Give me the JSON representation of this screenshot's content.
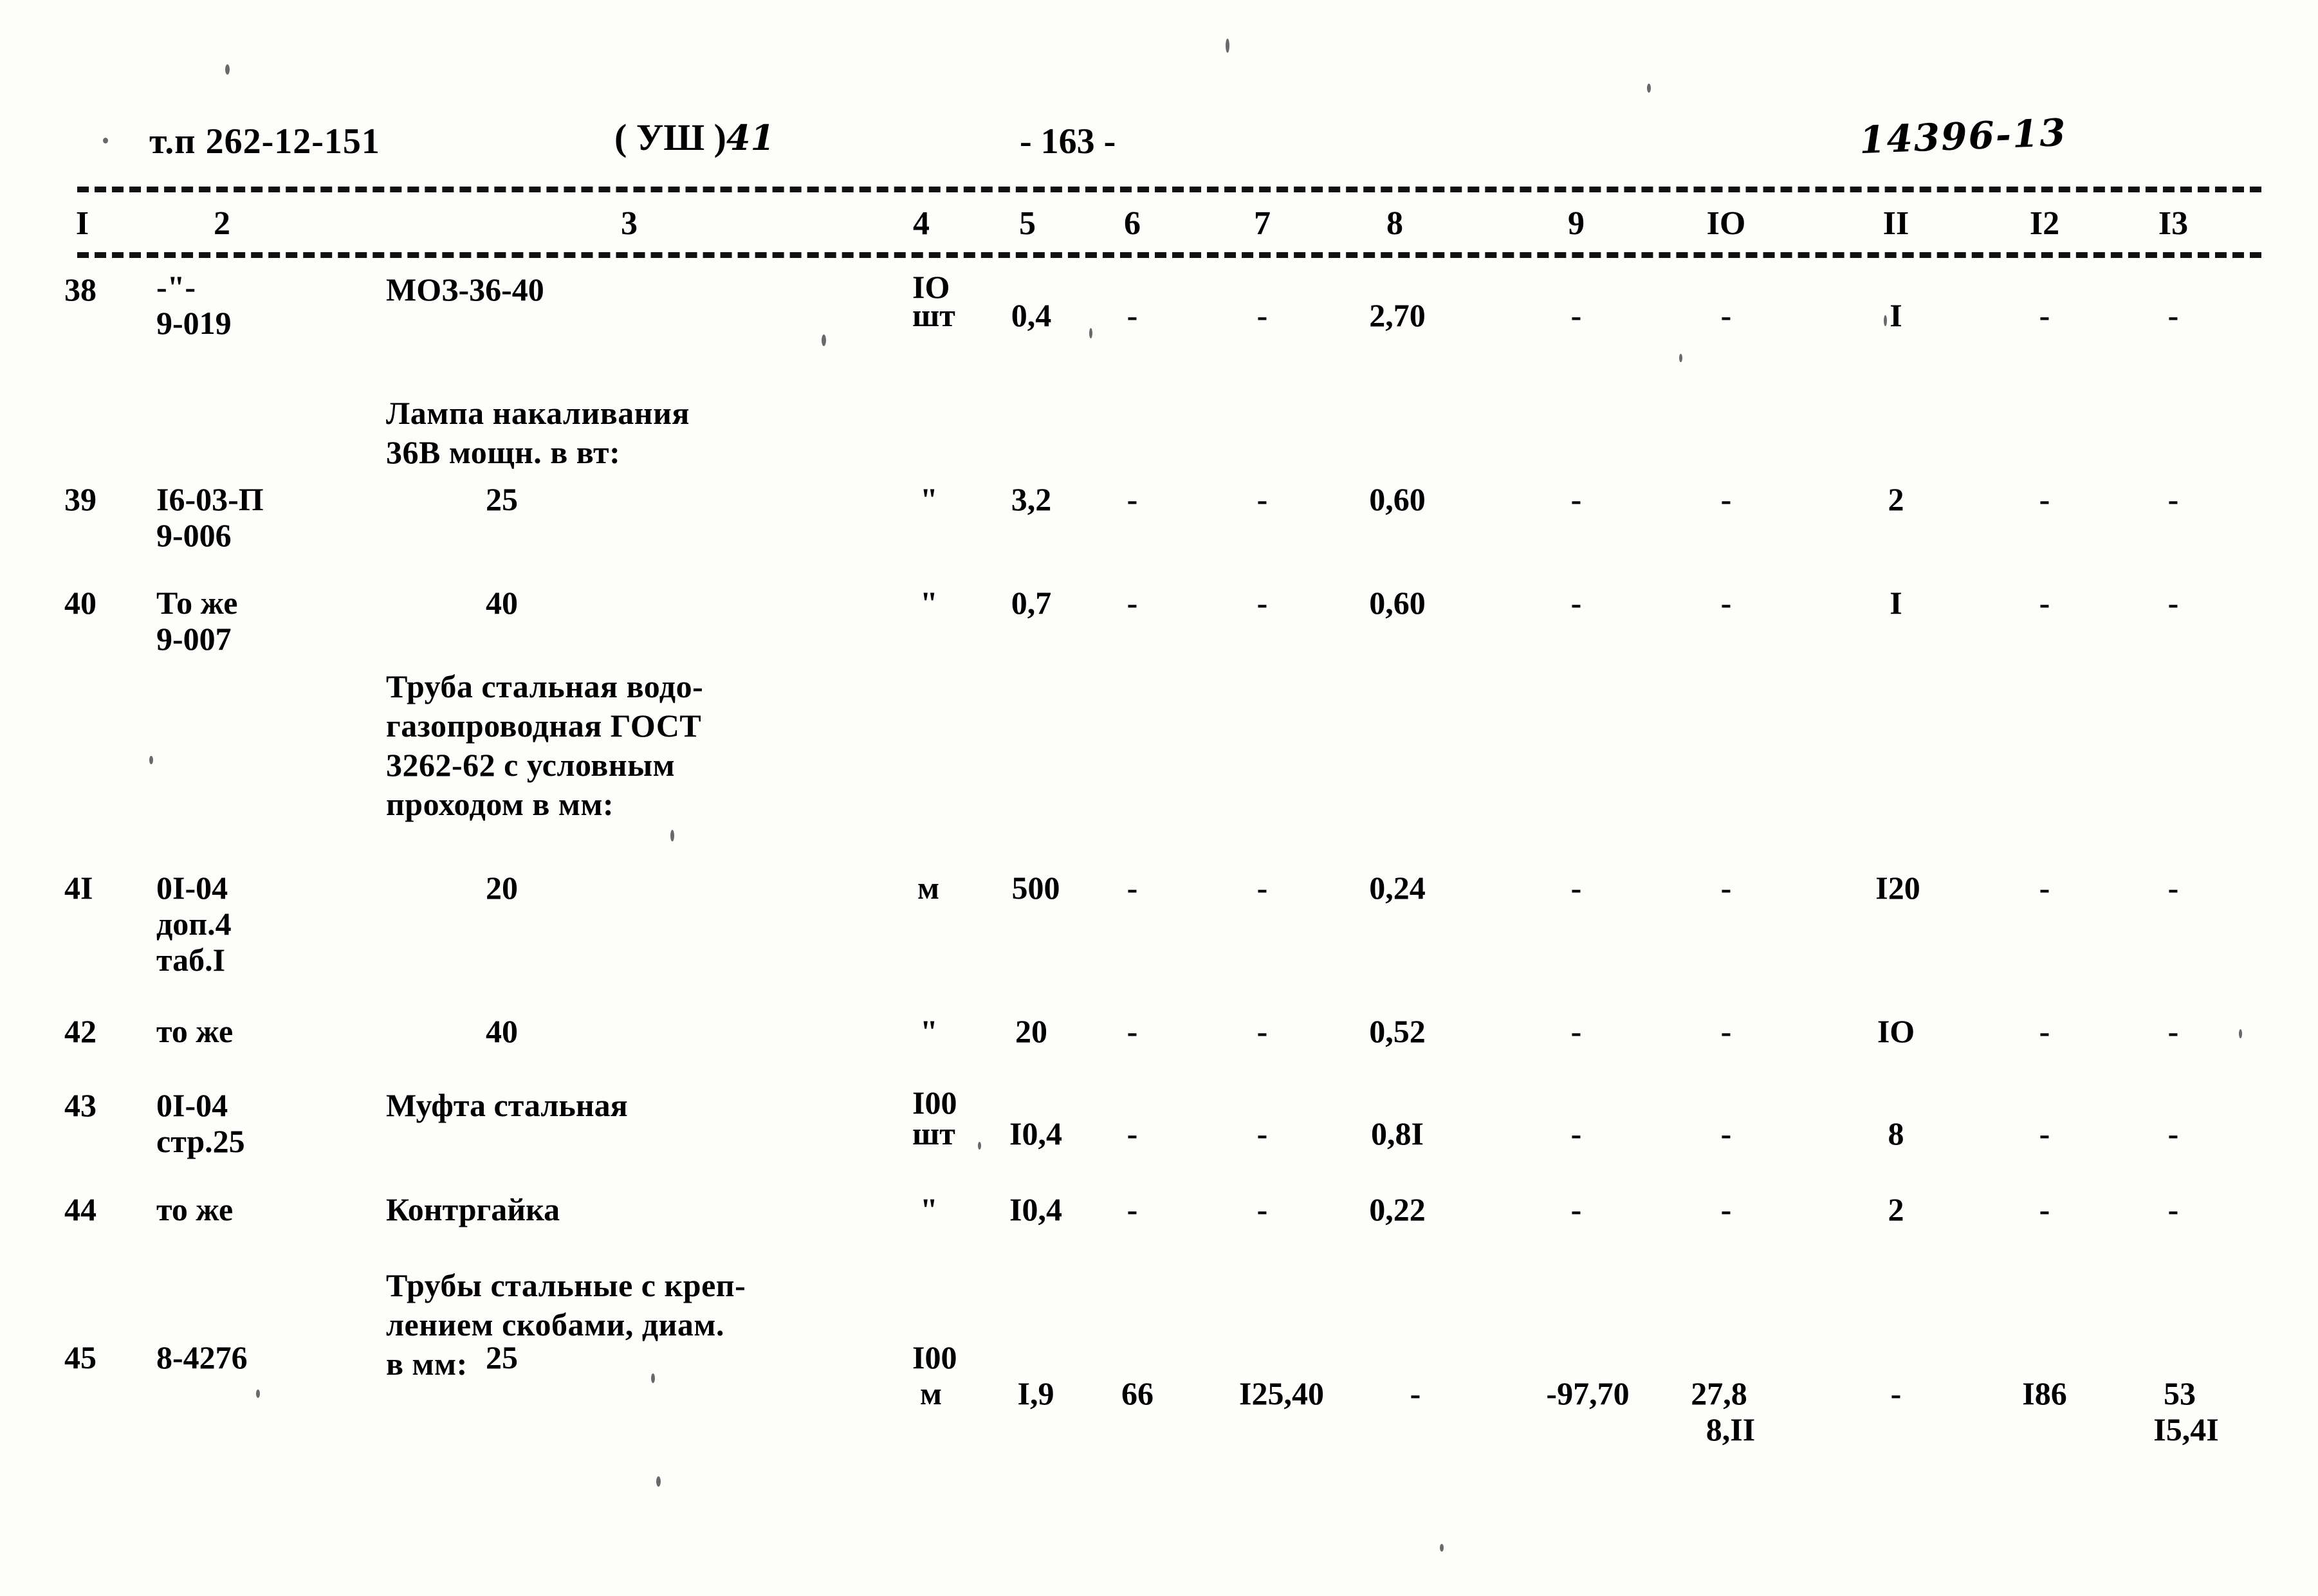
{
  "header": {
    "doc_code": "т.п 262-12-151",
    "volume": "( УШ )",
    "volume_hand": "41",
    "page_number": "- 163 -",
    "archive_code": "14396-13"
  },
  "table": {
    "column_numbers": [
      "I",
      "2",
      "3",
      "4",
      "5",
      "6",
      "7",
      "8",
      "9",
      "IO",
      "II",
      "I2",
      "I3"
    ],
    "group_headings": [
      {
        "id": "lamp",
        "text": "Лампа накаливания\n36В мощн. в вт:"
      },
      {
        "id": "pipe",
        "text": "Труба стальная водо-\nгазопроводная ГОСТ\n3262-62 с условным\nпроходом в мм:"
      },
      {
        "id": "clamped-pipe",
        "text": "Трубы стальные с креп-\nлением скобами, диам.\nв мм:"
      }
    ],
    "rows": [
      {
        "no": "38",
        "code_1": "-\"-",
        "code_2": "9-019",
        "name": "МОЗ-36-40",
        "unit_1": "IO",
        "unit_2": "шт",
        "c5": "0,4",
        "c6": "-",
        "c7": "-",
        "c8": "2,70",
        "c9": "-",
        "c10": "-",
        "c11": "I",
        "c12": "-",
        "c13": "-"
      },
      {
        "no": "39",
        "code_1": "I6-03-П",
        "code_2": "9-006",
        "name": "25",
        "unit_1": "",
        "unit_2": "\"",
        "c5": "3,2",
        "c6": "-",
        "c7": "-",
        "c8": "0,60",
        "c9": "-",
        "c10": "-",
        "c11": "2",
        "c12": "-",
        "c13": "-"
      },
      {
        "no": "40",
        "code_1": "То же",
        "code_2": "9-007",
        "name": "40",
        "unit_1": "",
        "unit_2": "\"",
        "c5": "0,7",
        "c6": "-",
        "c7": "-",
        "c8": "0,60",
        "c9": "-",
        "c10": "-",
        "c11": "I",
        "c12": "-",
        "c13": "-"
      },
      {
        "no": "4I",
        "code_1": "0I-04",
        "code_2": "доп.4",
        "code_3": "таб.I",
        "name": "20",
        "unit_1": "",
        "unit_2": "м",
        "c5": "500",
        "c6": "-",
        "c7": "-",
        "c8": "0,24",
        "c9": "-",
        "c10": "-",
        "c11": "I20",
        "c12": "-",
        "c13": "-"
      },
      {
        "no": "42",
        "code_1": "то же",
        "code_2": "",
        "name": "40",
        "unit_1": "",
        "unit_2": "\"",
        "c5": "20",
        "c6": "-",
        "c7": "-",
        "c8": "0,52",
        "c9": "-",
        "c10": "-",
        "c11": "IO",
        "c12": "-",
        "c13": "-"
      },
      {
        "no": "43",
        "code_1": "0I-04",
        "code_2": "стр.25",
        "name": "Муфта стальная",
        "unit_1": "I00",
        "unit_2": "шт",
        "c5": "I0,4",
        "c6": "-",
        "c7": "-",
        "c8": "0,8I",
        "c9": "-",
        "c10": "-",
        "c11": "8",
        "c12": "-",
        "c13": "-"
      },
      {
        "no": "44",
        "code_1": "то же",
        "code_2": "",
        "name": "Контргайка",
        "unit_1": "",
        "unit_2": "\"",
        "c5": "I0,4",
        "c6": "-",
        "c7": "-",
        "c8": "0,22",
        "c9": "-",
        "c10": "-",
        "c11": "2",
        "c12": "-",
        "c13": "-"
      },
      {
        "no": "45",
        "code_1": "8-4276",
        "code_2": "",
        "name": "25",
        "unit_1": "I00",
        "unit_2": "м",
        "c5": "I,9",
        "c6": "66",
        "c7": "I25,40",
        "c8": "-",
        "c9": "-97,70",
        "c10": "27,8",
        "c10b": "8,II",
        "c11": "-",
        "c12": "I86",
        "c13": "53",
        "c13b": "I5,4I"
      }
    ]
  }
}
